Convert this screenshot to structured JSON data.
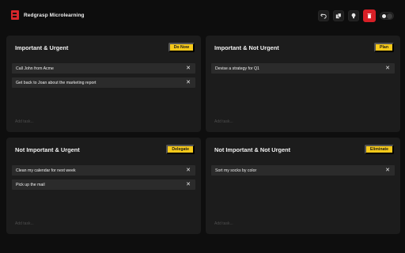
{
  "app": {
    "title": "Redgrasp Microlearning"
  },
  "toolbar": {
    "icons": [
      "undo-icon",
      "copy-icon",
      "lightbulb-icon",
      "trash-icon",
      "theme-toggle"
    ],
    "accent": "#d71f26"
  },
  "colors": {
    "action_button": "#f6c91a",
    "panel": "#1c1c1c",
    "task": "#2b2b2b",
    "background": "#0e0e0e"
  },
  "quadrants": [
    {
      "title": "Important & Urgent",
      "action": "Do Now",
      "tasks": [
        "Call John from Acme",
        "Get back to Joan about the marketing report"
      ],
      "placeholder": "Add task..."
    },
    {
      "title": "Important & Not Urgent",
      "action": "Plan",
      "tasks": [
        "Devise a strategy for Q1"
      ],
      "placeholder": "Add task..."
    },
    {
      "title": "Not Important & Urgent",
      "action": "Delegate",
      "tasks": [
        "Clean my calendar for next week",
        "Pick up the mail"
      ],
      "placeholder": "Add task..."
    },
    {
      "title": "Not Important & Not Urgent",
      "action": "Eliminate",
      "tasks": [
        "Sort my socks by color"
      ],
      "placeholder": "Add task..."
    }
  ]
}
